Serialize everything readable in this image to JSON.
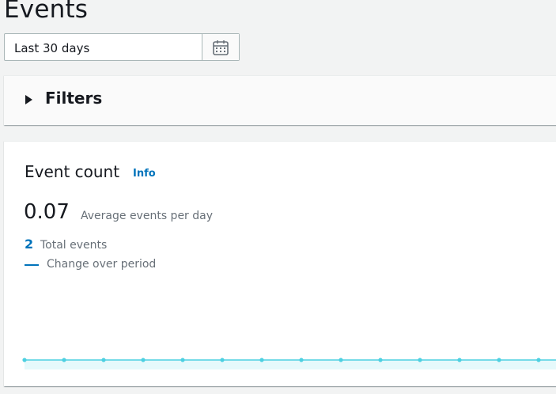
{
  "page": {
    "title": "Events"
  },
  "date_picker": {
    "value": "Last 30 days",
    "icon": "calendar-icon"
  },
  "filters": {
    "label": "Filters",
    "icon": "caret-right-icon"
  },
  "event_count": {
    "title": "Event count",
    "info_link": "Info",
    "average_value": "0.07",
    "average_label": "Average events per day",
    "total_value": "2",
    "total_label": "Total events",
    "change_label": "Change over period"
  },
  "colors": {
    "link_blue": "#0073bb",
    "series_line": "#4dd0e1",
    "series_fill": "#e0f7fa"
  },
  "chart_data": {
    "type": "area",
    "series": [
      {
        "values": [
          0,
          0,
          0,
          0,
          0,
          0,
          0,
          0,
          0,
          0,
          0,
          0,
          0,
          0,
          0
        ]
      }
    ]
  }
}
